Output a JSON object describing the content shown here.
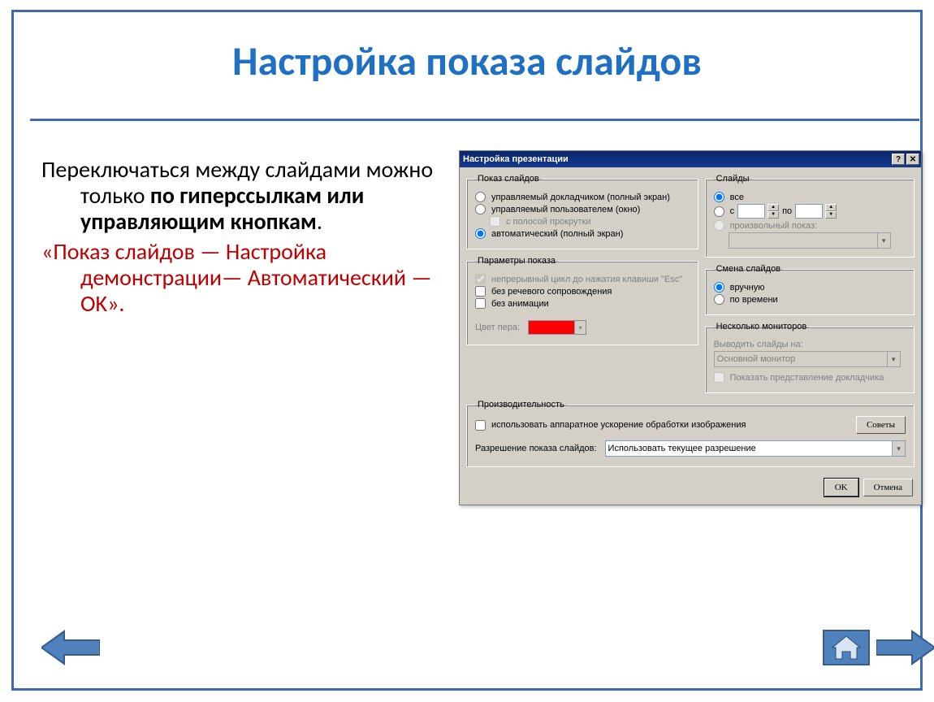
{
  "slide": {
    "title": "Настройка показа слайдов",
    "para1_a": "Переключаться между слайдами можно только ",
    "para1_b": "по гиперссылкам или управляющим кнопкам",
    "para1_c": ".",
    "para2": "«Показ слайдов — Настройка демонстрации— Автоматический — OK»."
  },
  "dialog": {
    "title": "Настройка презентации",
    "help_btn": "?",
    "close_btn": "✕",
    "groups": {
      "show": {
        "legend": "Показ слайдов",
        "opt_presenter": "управляемый докладчиком (полный экран)",
        "opt_browsed": "управляемый пользователем (окно)",
        "opt_scrollbar": "с полосой прокрутки",
        "opt_kiosk": "автоматический (полный экран)"
      },
      "slides": {
        "legend": "Слайды",
        "opt_all": "все",
        "opt_from_label": "с",
        "opt_to_label": "по",
        "opt_custom": "произвольный показ:"
      },
      "options": {
        "legend": "Параметры показа",
        "chk_loop": "непрерывный цикл до нажатия клавиши \"Esc\"",
        "chk_no_narration": "без речевого сопровождения",
        "chk_no_animation": "без анимации",
        "pen_label": "Цвет пера:",
        "pen_color": "#ff0000"
      },
      "advance": {
        "legend": "Смена слайдов",
        "opt_manual": "вручную",
        "opt_timings": "по времени"
      },
      "monitors": {
        "legend": "Несколько мониторов",
        "display_on": "Выводить слайды на:",
        "primary": "Основной монитор",
        "presenter_view": "Показать представление докладчика"
      },
      "perf": {
        "legend": "Производительность",
        "chk_hw": "использовать аппаратное ускорение обработки изображения",
        "btn_tips": "Советы",
        "res_label": "Разрешение показа слайдов:",
        "res_value": "Использовать текущее разрешение"
      }
    },
    "buttons": {
      "ok": "OK",
      "cancel": "Отмена"
    }
  }
}
